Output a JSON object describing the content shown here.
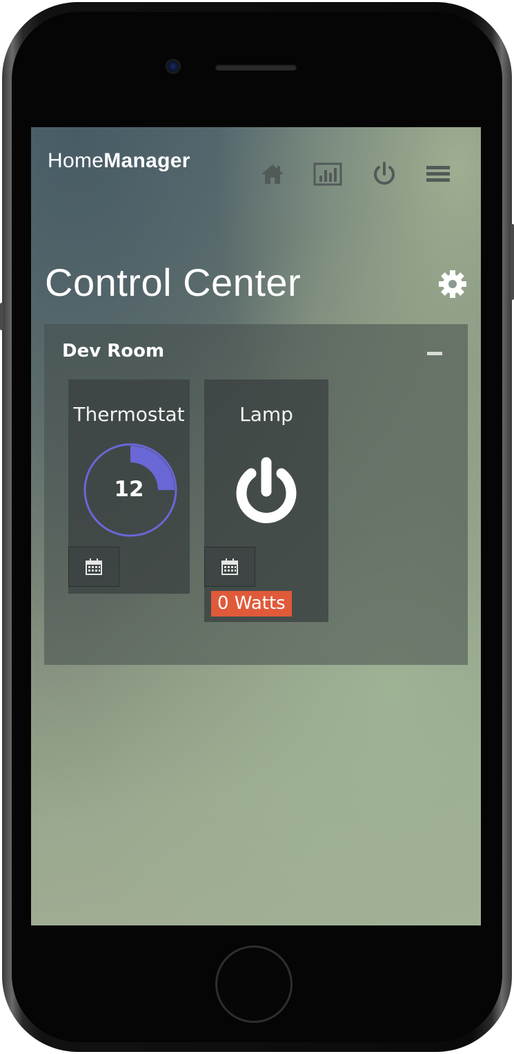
{
  "app": {
    "brand_prefix": "Home",
    "brand_suffix": "Manager"
  },
  "nav": {
    "icons": [
      "home-icon",
      "chart-icon",
      "power-icon",
      "menu-icon"
    ]
  },
  "page": {
    "title": "Control Center"
  },
  "room": {
    "name": "Dev Room"
  },
  "devices": {
    "thermostat": {
      "label": "Thermostat",
      "value": "12",
      "dial_fill_fraction": 0.25,
      "accent_color": "#6a67d6"
    },
    "lamp": {
      "label": "Lamp",
      "power_label": "0 Watts",
      "badge_color": "#e05a3a"
    }
  }
}
